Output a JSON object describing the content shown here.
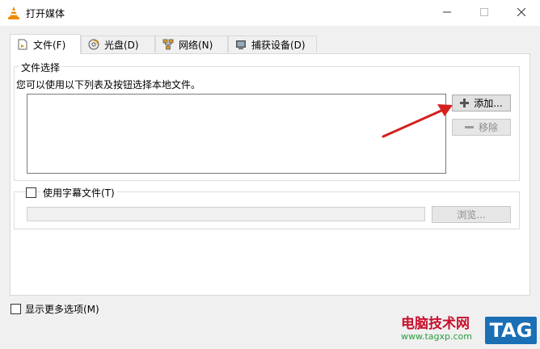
{
  "window": {
    "title": "打开媒体"
  },
  "tabs": [
    {
      "label": "文件(F)",
      "icon": "file-icon",
      "active": true
    },
    {
      "label": "光盘(D)",
      "icon": "disc-icon",
      "active": false
    },
    {
      "label": "网络(N)",
      "icon": "network-icon",
      "active": false
    },
    {
      "label": "捕获设备(D)",
      "icon": "capture-device-icon",
      "active": false
    }
  ],
  "file_selection": {
    "legend": "文件选择",
    "description": "您可以使用以下列表及按钮选择本地文件。",
    "add_button": "添加...",
    "remove_button": "移除"
  },
  "subtitle": {
    "checkbox_label": "使用字幕文件(T)",
    "checked": false,
    "path_value": "",
    "browse_button": "浏览..."
  },
  "footer": {
    "more_options_label": "显示更多选项(M)",
    "checked": false
  },
  "watermark": {
    "brand": "电脑技术网",
    "url": "www.tagxp.com",
    "tag": "TAG"
  },
  "colors": {
    "arrow": "#d42020",
    "vlc_orange": "#f08a00",
    "watermark_blue": "#1b6fb5"
  }
}
